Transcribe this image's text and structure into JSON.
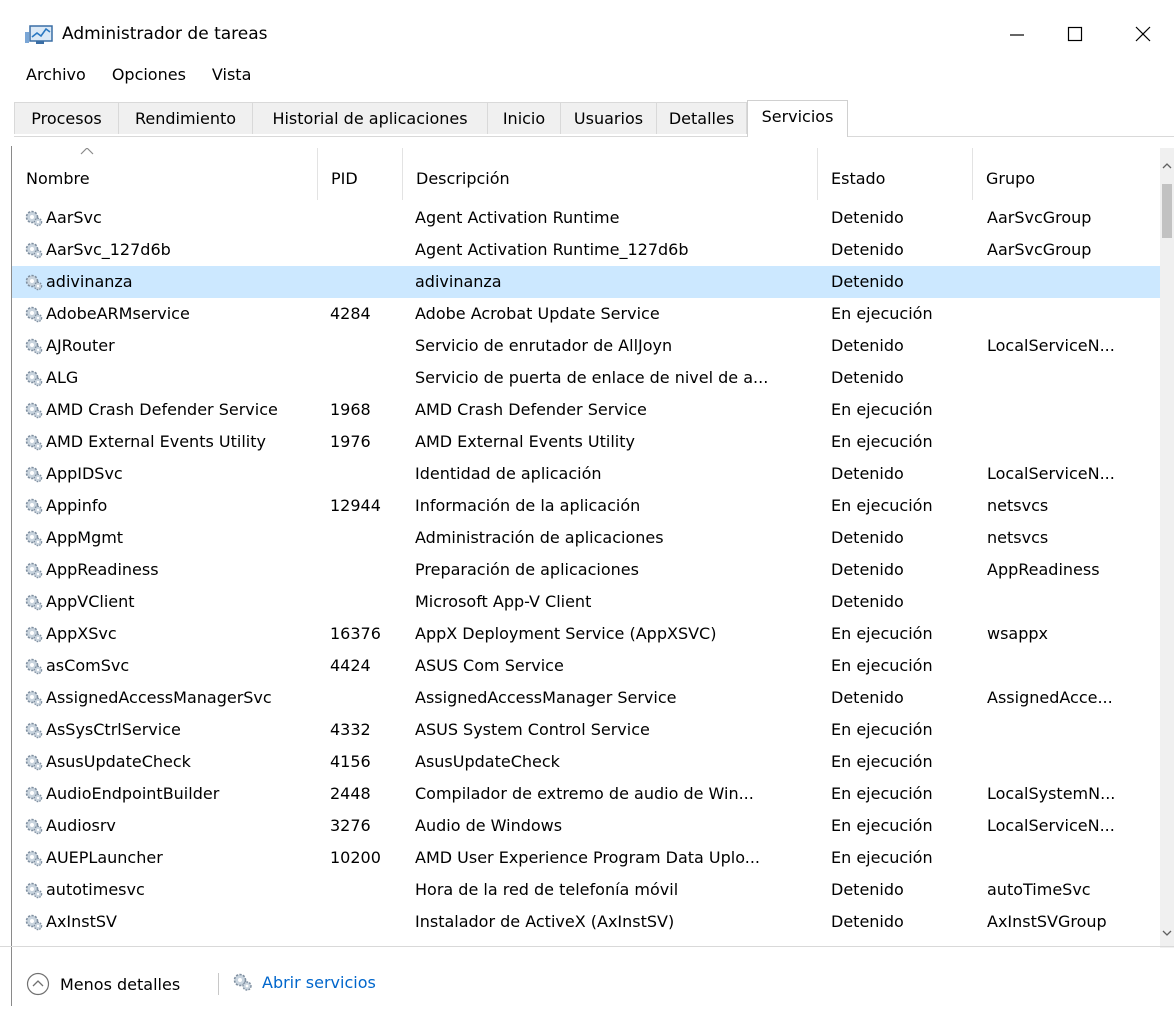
{
  "window": {
    "title": "Administrador de tareas",
    "minimize_glyph": "—",
    "maximize_glyph": "☐",
    "close_glyph": "✕"
  },
  "menu": [
    "Archivo",
    "Opciones",
    "Vista"
  ],
  "tabs": [
    {
      "label": "Procesos"
    },
    {
      "label": "Rendimiento"
    },
    {
      "label": "Historial de aplicaciones"
    },
    {
      "label": "Inicio"
    },
    {
      "label": "Usuarios"
    },
    {
      "label": "Detalles"
    },
    {
      "label": "Servicios",
      "active": true
    }
  ],
  "columns": [
    "Nombre",
    "PID",
    "Descripción",
    "Estado",
    "Grupo"
  ],
  "rows": [
    {
      "name": "AarSvc",
      "pid": "",
      "desc": "Agent Activation Runtime",
      "state": "Detenido",
      "group": "AarSvcGroup"
    },
    {
      "name": "AarSvc_127d6b",
      "pid": "",
      "desc": "Agent Activation Runtime_127d6b",
      "state": "Detenido",
      "group": "AarSvcGroup"
    },
    {
      "name": "adivinanza",
      "pid": "",
      "desc": "adivinanza",
      "state": "Detenido",
      "group": "",
      "selected": true
    },
    {
      "name": "AdobeARMservice",
      "pid": "4284",
      "desc": "Adobe Acrobat Update Service",
      "state": "En ejecución",
      "group": ""
    },
    {
      "name": "AJRouter",
      "pid": "",
      "desc": "Servicio de enrutador de AllJoyn",
      "state": "Detenido",
      "group": "LocalServiceN..."
    },
    {
      "name": "ALG",
      "pid": "",
      "desc": "Servicio de puerta de enlace de nivel de a...",
      "state": "Detenido",
      "group": ""
    },
    {
      "name": "AMD Crash Defender Service",
      "pid": "1968",
      "desc": "AMD Crash Defender Service",
      "state": "En ejecución",
      "group": ""
    },
    {
      "name": "AMD External Events Utility",
      "pid": "1976",
      "desc": "AMD External Events Utility",
      "state": "En ejecución",
      "group": ""
    },
    {
      "name": "AppIDSvc",
      "pid": "",
      "desc": "Identidad de aplicación",
      "state": "Detenido",
      "group": "LocalServiceN..."
    },
    {
      "name": "Appinfo",
      "pid": "12944",
      "desc": "Información de la aplicación",
      "state": "En ejecución",
      "group": "netsvcs"
    },
    {
      "name": "AppMgmt",
      "pid": "",
      "desc": "Administración de aplicaciones",
      "state": "Detenido",
      "group": "netsvcs"
    },
    {
      "name": "AppReadiness",
      "pid": "",
      "desc": "Preparación de aplicaciones",
      "state": "Detenido",
      "group": "AppReadiness"
    },
    {
      "name": "AppVClient",
      "pid": "",
      "desc": "Microsoft App-V Client",
      "state": "Detenido",
      "group": ""
    },
    {
      "name": "AppXSvc",
      "pid": "16376",
      "desc": "AppX Deployment Service (AppXSVC)",
      "state": "En ejecución",
      "group": "wsappx"
    },
    {
      "name": "asComSvc",
      "pid": "4424",
      "desc": "ASUS Com Service",
      "state": "En ejecución",
      "group": ""
    },
    {
      "name": "AssignedAccessManagerSvc",
      "pid": "",
      "desc": "AssignedAccessManager Service",
      "state": "Detenido",
      "group": "AssignedAcce..."
    },
    {
      "name": "AsSysCtrlService",
      "pid": "4332",
      "desc": "ASUS System Control Service",
      "state": "En ejecución",
      "group": ""
    },
    {
      "name": "AsusUpdateCheck",
      "pid": "4156",
      "desc": "AsusUpdateCheck",
      "state": "En ejecución",
      "group": ""
    },
    {
      "name": "AudioEndpointBuilder",
      "pid": "2448",
      "desc": "Compilador de extremo de audio de Win...",
      "state": "En ejecución",
      "group": "LocalSystemN..."
    },
    {
      "name": "Audiosrv",
      "pid": "3276",
      "desc": "Audio de Windows",
      "state": "En ejecución",
      "group": "LocalServiceN..."
    },
    {
      "name": "AUEPLauncher",
      "pid": "10200",
      "desc": "AMD User Experience Program Data Uplo...",
      "state": "En ejecución",
      "group": ""
    },
    {
      "name": "autotimesvc",
      "pid": "",
      "desc": "Hora de la red de telefonía móvil",
      "state": "Detenido",
      "group": "autoTimeSvc"
    },
    {
      "name": "AxInstSV",
      "pid": "",
      "desc": "Instalador de ActiveX (AxInstSV)",
      "state": "Detenido",
      "group": "AxInstSVGroup"
    }
  ],
  "footer": {
    "less_details": "Menos detalles",
    "open_services": "Abrir servicios"
  },
  "colors": {
    "selected_row": "#cce8ff",
    "link": "#0066cc"
  }
}
